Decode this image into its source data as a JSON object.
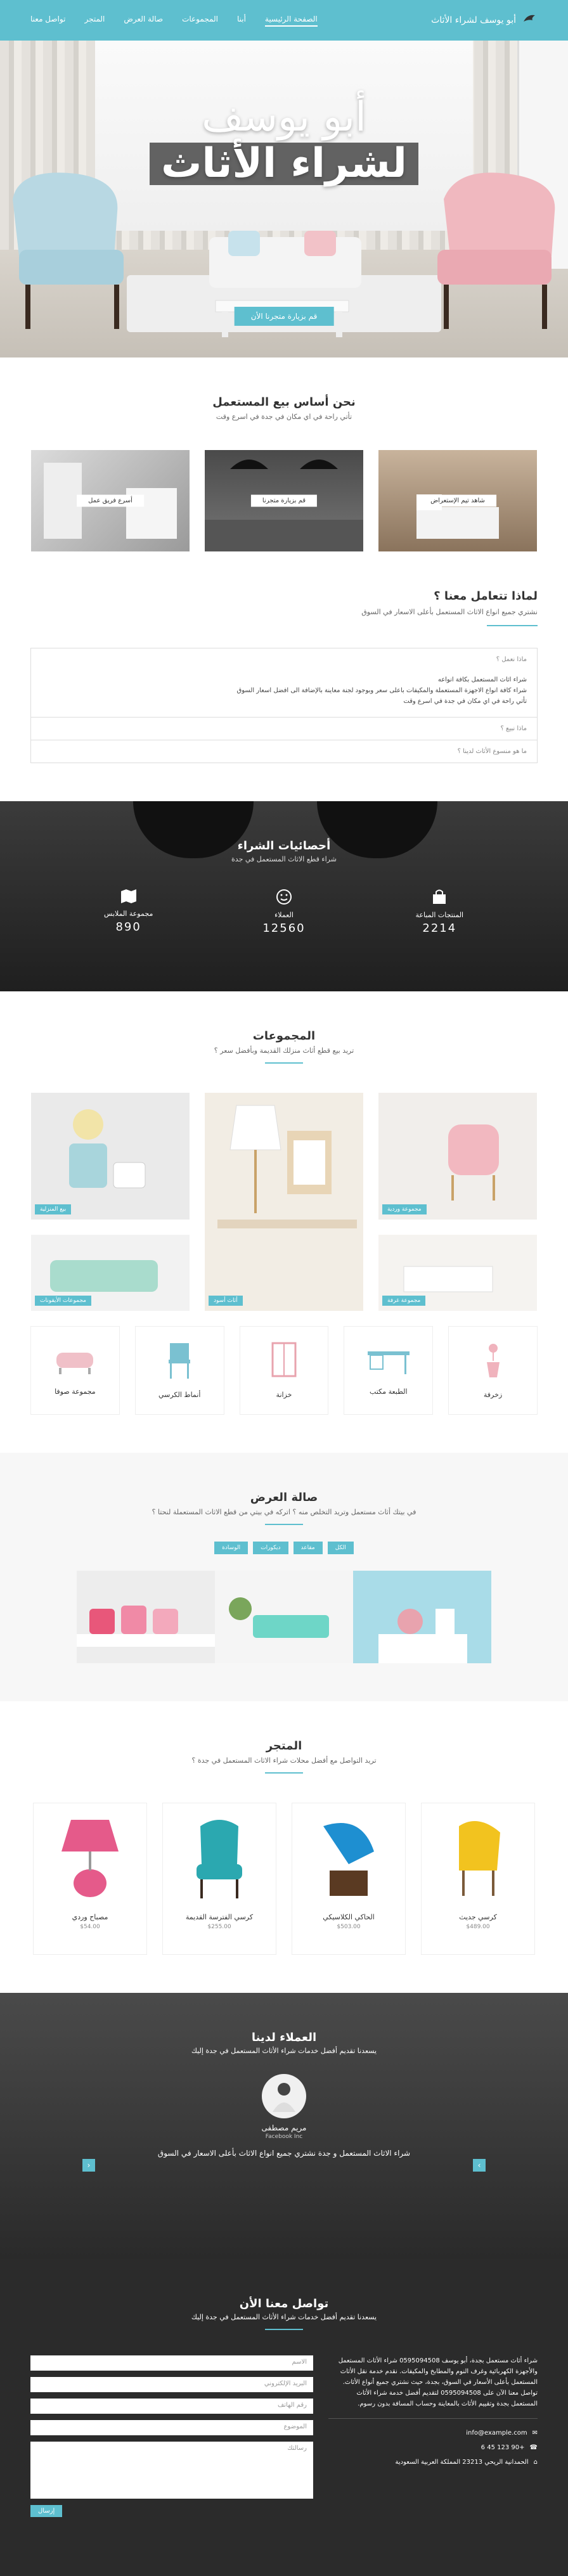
{
  "nav": {
    "brand": "أبو يوسف لشراء الأثاث",
    "items": [
      "الصفحة الرئيسية",
      "أبنا",
      "المجموعات",
      "صالة العرض",
      "المتجر",
      "تواصل معنا"
    ]
  },
  "hero": {
    "line1": "أبو يوسف",
    "line2": "لشراء الأثاث",
    "button": "قم بزيارة متجرنا الأن"
  },
  "about": {
    "title": "نحن أساس بيع المستعمل",
    "subtitle": "تأتي راحة في اي مكان في جدة في اسرع وقت",
    "tiles": [
      "أسرع فريق عمل",
      "قم بزيارة متجرنا",
      "شاهد تيم الإستعراض"
    ]
  },
  "why": {
    "title": "لماذا تتعامل معنا ؟",
    "subtitle": "نشتري جميع انواع الاثاث المستعمل بأعلى الاسعار في السوق",
    "items": [
      {
        "q": "ماذا نعمل ؟",
        "a": "شراء اثاث المستعمل بكافة انواعه\nشراء كافة انواع الاجهزة المستعملة والمكيفات باعلى سعر وبوجود لجنة معاينة بالإضافة الى افضل اسعار السوق\nتأتي راحة في اي مكان في جدة في اسرع وقت"
      },
      {
        "q": "ماذا نبيع ؟",
        "a": ""
      },
      {
        "q": "ما هو منسوع الأثاث لدينا ؟",
        "a": ""
      }
    ]
  },
  "stats": {
    "title": "أحصائيات الشراء",
    "subtitle": "شراء قطع الاثاث المستعمل في جدة",
    "items": [
      {
        "label": "مجموعة الملابس",
        "value": "890",
        "icon": "map-icon"
      },
      {
        "label": "العملاء",
        "value": "12560",
        "icon": "smile-icon"
      },
      {
        "label": "المنتجات المباعة",
        "value": "2214",
        "icon": "bag-icon"
      }
    ]
  },
  "collections": {
    "title": "المجموعات",
    "subtitle": "تريد بيع قطع أثاث منزلك القديمة وبأفضل سعر ؟",
    "tags": [
      "بيع المنزلية",
      "",
      "مجموعة وردية",
      "مجموعات الأيقونات",
      "أثاث أسود",
      "مجموعة غرفة"
    ],
    "categories": [
      "مجموعة صوفا",
      "أنماط الكرسي",
      "خزانة",
      "الطبعة مكتب",
      "زخرفة"
    ]
  },
  "gallery": {
    "title": "صالة العرض",
    "subtitle": "في بيتك أثاث مستعمل وتريد التخلص منه ؟ اتركه في بيتي من قطع الاثاث المستعملة لنحتا ؟",
    "filters": [
      "الوسادة",
      "ديكورات",
      "مقاعد",
      "الكل"
    ]
  },
  "shop": {
    "title": "المتجر",
    "subtitle": "تريد التواصل مع أفضل محلات شراء الاثاث المستعمل في جدة ؟",
    "products": [
      {
        "name": "مصباح وردي",
        "price": "$54.00"
      },
      {
        "name": "كرسي الفترسة القديمة",
        "price": "$255.00"
      },
      {
        "name": "الحاكي الكلاسيكي",
        "price": "$503.00"
      },
      {
        "name": "كرسي جديث",
        "price": "$489.00"
      }
    ]
  },
  "testimonials": {
    "title": "العملاء لدينا",
    "subtitle": "يسعدنا تقديم أفضل خدمات شراء الأثاث المستعمل في جدة إليك",
    "name": "مريم مصطفى",
    "company": "Facebook Inc",
    "quote": "شراء الاثاث المستعمل و جدة نشتري جميع انواع الاثاث بأعلى الاسعار في السوق"
  },
  "contact": {
    "title": "تواصل معنا الأن",
    "subtitle": "يسعدنا تقديم أفضل خدمات شراء الأثاث المستعمل في جدة إليك",
    "about": "شراء أثاث مستعمل بجدة، أبو يوسف 0595094508 شراء الأثاث المستعمل والأجهزة الكهربائية وغرف النوم والمطابخ والمكيفات. نقدم خدمة نقل الأثاث المستعمل بأعلى الأسعار في السوق، بجدة، حيث نشتري جميع أنواع الأثاث. تواصل معنا الآن على 0595094508 لتقديم أفضل خدمة شراء الأثاث المستعمل بجدة وتقييم الأثاث بالمعاينة وحساب المسافة بدون رسوم.",
    "email": "info@example.com",
    "phone": "+90 123 45 6",
    "address": "الحمدانية الريحي 23213 المملكة العربية السعودية",
    "fields": [
      "الاسم",
      "البريد الإلكتروني",
      "رقم الهاتف",
      "الموضوع",
      "رسالتك"
    ],
    "send": "إرسال"
  }
}
